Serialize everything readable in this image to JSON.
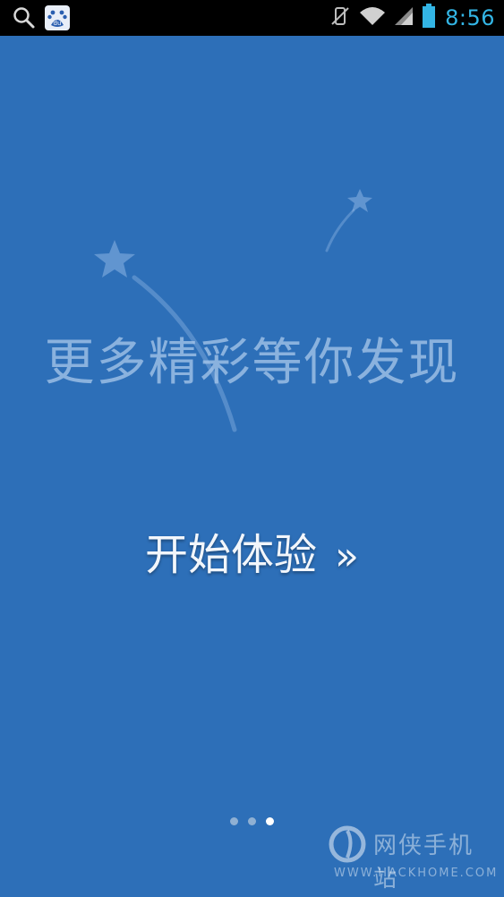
{
  "status_bar": {
    "time": "8:56",
    "icons": [
      "search-icon",
      "baidu-app-icon",
      "vibrate-icon",
      "wifi-icon",
      "signal-icon",
      "battery-icon"
    ],
    "baidu_icon_text": "du"
  },
  "colors": {
    "background": "#2d6fb8",
    "status_bar": "#000000",
    "time": "#33b5e5",
    "headline": "#aac8eb",
    "button_text": "#f2f6fb"
  },
  "main": {
    "headline": "更多精彩等你发现",
    "start_button_label": "开始体验",
    "start_button_chevron": "»",
    "page_indicator": {
      "total": 3,
      "active": 3
    }
  },
  "watermark": {
    "title": "网侠手机站",
    "url": "WWW.HACKHOME.COM"
  }
}
